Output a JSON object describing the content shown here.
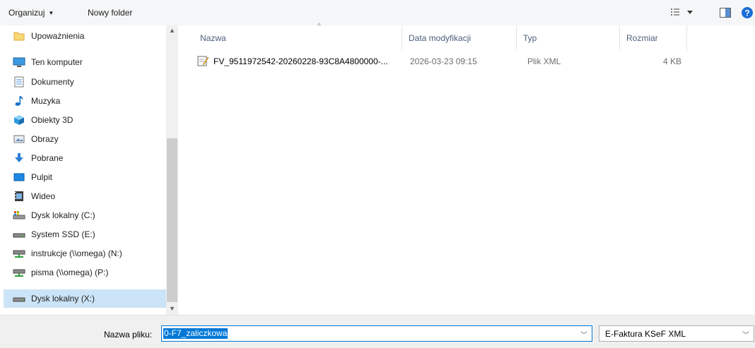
{
  "toolbar": {
    "organize_label": "Organizuj",
    "new_folder_label": "Nowy folder"
  },
  "nav": {
    "items": [
      {
        "label": "Upoważnienia",
        "icon": "folder-icon",
        "top": false,
        "selected": false
      },
      {
        "label": "Ten komputer",
        "icon": "computer-icon",
        "top": true,
        "selected": false
      },
      {
        "label": "Dokumenty",
        "icon": "document-icon",
        "top": false,
        "selected": false
      },
      {
        "label": "Muzyka",
        "icon": "music-icon",
        "top": false,
        "selected": false
      },
      {
        "label": "Obiekty 3D",
        "icon": "cube-icon",
        "top": false,
        "selected": false
      },
      {
        "label": "Obrazy",
        "icon": "pictures-icon",
        "top": false,
        "selected": false
      },
      {
        "label": "Pobrane",
        "icon": "download-icon",
        "top": false,
        "selected": false
      },
      {
        "label": "Pulpit",
        "icon": "desktop-icon",
        "top": false,
        "selected": false
      },
      {
        "label": "Wideo",
        "icon": "video-icon",
        "top": false,
        "selected": false
      },
      {
        "label": "Dysk lokalny (C:)",
        "icon": "system-drive-icon",
        "top": false,
        "selected": false
      },
      {
        "label": "System SSD (E:)",
        "icon": "drive-icon",
        "top": false,
        "selected": false
      },
      {
        "label": "instrukcje (\\\\omega) (N:)",
        "icon": "network-drive-icon",
        "top": false,
        "selected": false
      },
      {
        "label": "pisma (\\\\omega) (P:)",
        "icon": "network-drive-icon",
        "top": false,
        "selected": false
      },
      {
        "label": "Dysk lokalny (X:)",
        "icon": "drive-icon",
        "top": false,
        "selected": true
      }
    ]
  },
  "list": {
    "columns": {
      "name": "Nazwa",
      "modified": "Data modyfikacji",
      "type": "Typ",
      "size": "Rozmiar"
    },
    "rows": [
      {
        "name": "FV_9511972542-20260228-93C8A4800000-...",
        "modified": "2026-03-23 09:15",
        "type": "Plik XML",
        "size": "4 KB",
        "icon": "xml-file-icon"
      }
    ]
  },
  "footer": {
    "filename_label": "Nazwa pliku:",
    "filename_value": "0-F7_zaliczkowa",
    "filetype_value": "E-Faktura KSeF XML"
  },
  "colors": {
    "accent": "#0078d7",
    "selection": "#cce4f7",
    "help": "#1a6dd6"
  }
}
